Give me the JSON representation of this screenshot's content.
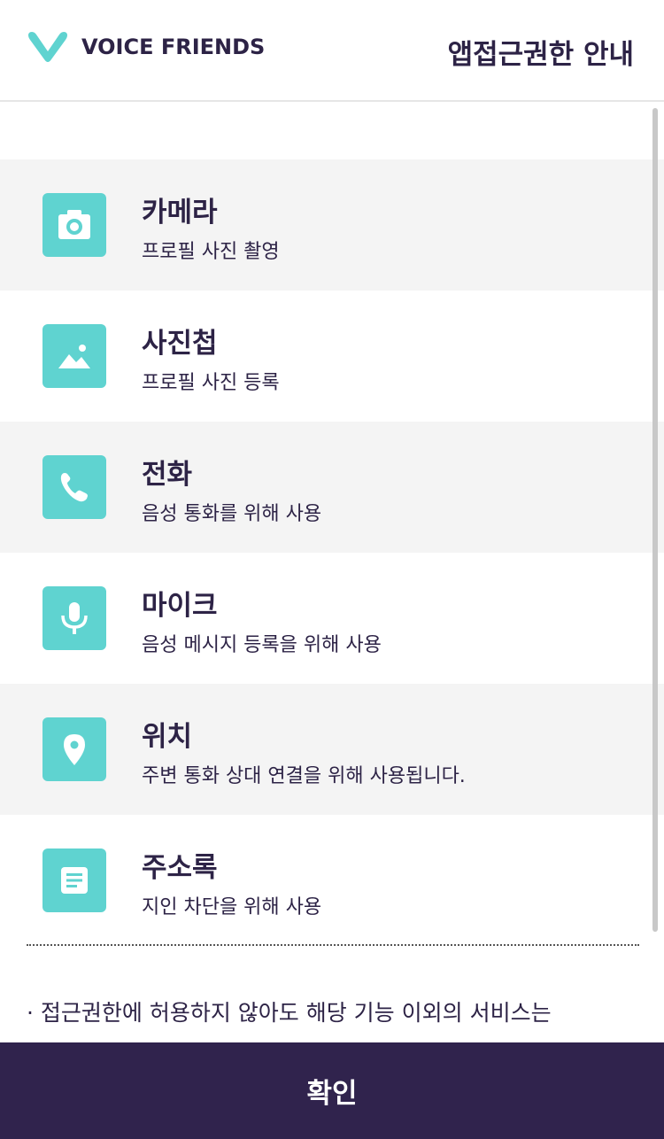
{
  "header": {
    "brand": "VOICE FRIENDS",
    "title": "앱접근권한 안내"
  },
  "permissions": [
    {
      "icon": "camera-icon",
      "title": "카메라",
      "desc": "프로필 사진 촬영"
    },
    {
      "icon": "image-icon",
      "title": "사진첩",
      "desc": "프로필 사진 등록"
    },
    {
      "icon": "phone-icon",
      "title": "전화",
      "desc": "음성 통화를 위해 사용"
    },
    {
      "icon": "microphone-icon",
      "title": "마이크",
      "desc": "음성 메시지 등록을 위해 사용"
    },
    {
      "icon": "location-pin-icon",
      "title": "위치",
      "desc": "주변 통화 상대 연결을 위해 사용됩니다."
    },
    {
      "icon": "contacts-icon",
      "title": "주소록",
      "desc": "지인 차단을 위해 사용"
    }
  ],
  "notice": "· 접근권한에 허용하지 않아도 해당 기능 이외의 서비스는",
  "confirm_label": "확인",
  "colors": {
    "accent": "#5fd3d0",
    "brand": "#2d2346",
    "button": "#30234d",
    "row_alt": "#f4f4f4"
  }
}
